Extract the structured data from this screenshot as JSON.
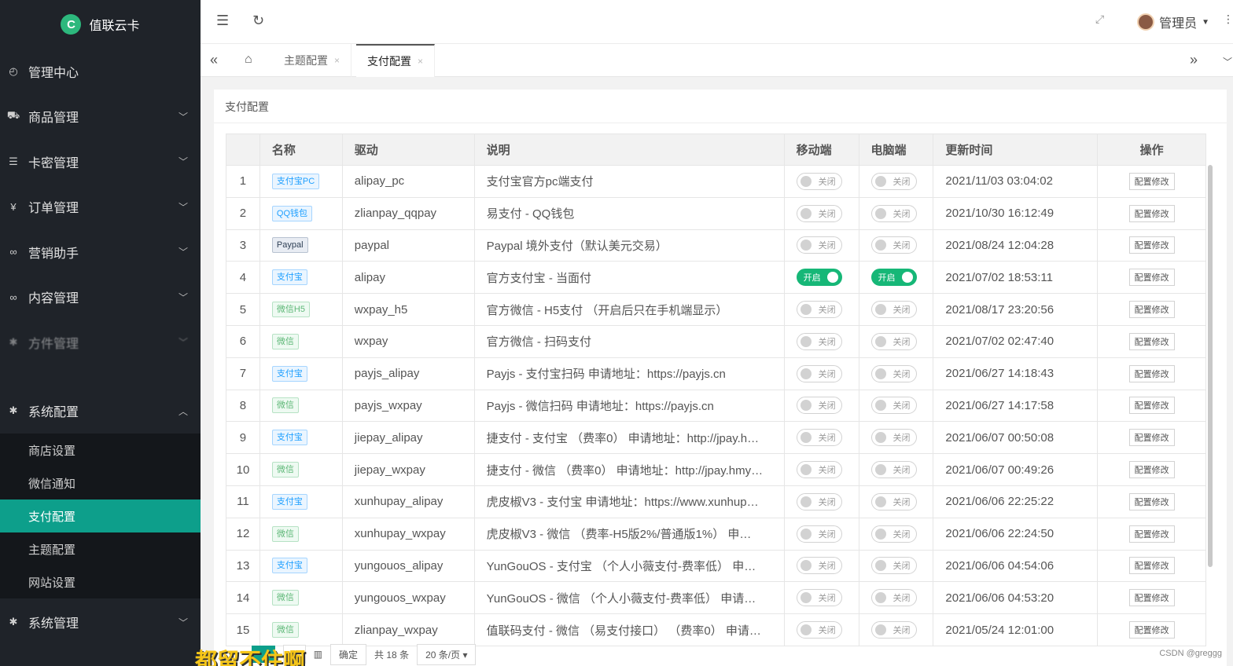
{
  "brand": {
    "name": "值联云卡",
    "logo_letter": "C"
  },
  "sidebar": {
    "items": [
      {
        "label": "管理中心",
        "icon": "dashboard-icon",
        "glyph": "◴"
      },
      {
        "label": "商品管理",
        "icon": "cart-icon",
        "glyph": "⛟"
      },
      {
        "label": "卡密管理",
        "icon": "stack-icon",
        "glyph": "☰"
      },
      {
        "label": "订单管理",
        "icon": "yen-icon",
        "glyph": "¥"
      },
      {
        "label": "营销助手",
        "icon": "link-icon",
        "glyph": "∞"
      },
      {
        "label": "内容管理",
        "icon": "link-icon",
        "glyph": "∞"
      },
      {
        "label": "方件管理",
        "icon": "gear-icon",
        "glyph": "✱"
      }
    ],
    "system_config": {
      "label": "系统配置",
      "icon": "gear-icon",
      "glyph": "✱"
    },
    "sub_items": [
      "商店设置",
      "微信通知",
      "支付配置",
      "主题配置",
      "网站设置"
    ],
    "active_sub": "支付配置",
    "system_manage": {
      "label": "系统管理",
      "icon": "gear-icon",
      "glyph": "✱"
    }
  },
  "topbar": {
    "admin_label": "管理员"
  },
  "tabs": [
    {
      "label": "主题配置"
    },
    {
      "label": "支付配置"
    }
  ],
  "card": {
    "title": "支付配置"
  },
  "table": {
    "headers": [
      "名称",
      "驱动",
      "说明",
      "移动端",
      "电脑端",
      "更新时间",
      "操作"
    ],
    "switch_off": "关闭",
    "switch_on": "开启",
    "op_label": "配置修改",
    "rows": [
      {
        "id": "1",
        "name": "支付宝PC",
        "color": "blue",
        "driver": "alipay_pc",
        "desc": "支付宝官方pc端支付",
        "mobile": false,
        "pc": false,
        "time": "2021/11/03 03:04:02"
      },
      {
        "id": "2",
        "name": "QQ钱包",
        "color": "blue",
        "driver": "zlianpay_qqpay",
        "desc": "易支付 - QQ钱包",
        "mobile": false,
        "pc": false,
        "time": "2021/10/30 16:12:49"
      },
      {
        "id": "3",
        "name": "Paypal",
        "color": "navy",
        "driver": "paypal",
        "desc": "Paypal 境外支付（默认美元交易）",
        "mobile": false,
        "pc": false,
        "time": "2021/08/24 12:04:28"
      },
      {
        "id": "4",
        "name": "支付宝",
        "color": "blue",
        "driver": "alipay",
        "desc": "官方支付宝 - 当面付",
        "mobile": true,
        "pc": true,
        "time": "2021/07/02 18:53:11"
      },
      {
        "id": "5",
        "name": "微信H5",
        "color": "green",
        "driver": "wxpay_h5",
        "desc": "官方微信 - H5支付 （开启后只在手机端显示）",
        "mobile": false,
        "pc": false,
        "time": "2021/08/17 23:20:56"
      },
      {
        "id": "6",
        "name": "微信",
        "color": "green",
        "driver": "wxpay",
        "desc": "官方微信 - 扫码支付",
        "mobile": false,
        "pc": false,
        "time": "2021/07/02 02:47:40"
      },
      {
        "id": "7",
        "name": "支付宝",
        "color": "blue",
        "driver": "payjs_alipay",
        "desc": "Payjs - 支付宝扫码 申请地址：https://payjs.cn",
        "mobile": false,
        "pc": false,
        "time": "2021/06/27 14:18:43"
      },
      {
        "id": "8",
        "name": "微信",
        "color": "green",
        "driver": "payjs_wxpay",
        "desc": "Payjs - 微信扫码 申请地址：https://payjs.cn",
        "mobile": false,
        "pc": false,
        "time": "2021/06/27 14:17:58"
      },
      {
        "id": "9",
        "name": "支付宝",
        "color": "blue",
        "driver": "jiepay_alipay",
        "desc": "捷支付 - 支付宝 （费率0） 申请地址：http://jpay.h…",
        "mobile": false,
        "pc": false,
        "time": "2021/06/07 00:50:08"
      },
      {
        "id": "10",
        "name": "微信",
        "color": "green",
        "driver": "jiepay_wxpay",
        "desc": "捷支付 - 微信 （费率0） 申请地址：http://jpay.hmy…",
        "mobile": false,
        "pc": false,
        "time": "2021/06/07 00:49:26"
      },
      {
        "id": "11",
        "name": "支付宝",
        "color": "blue",
        "driver": "xunhupay_alipay",
        "desc": "虎皮椒V3 - 支付宝 申请地址：https://www.xunhup…",
        "mobile": false,
        "pc": false,
        "time": "2021/06/06 22:25:22"
      },
      {
        "id": "12",
        "name": "微信",
        "color": "green",
        "driver": "xunhupay_wxpay",
        "desc": "虎皮椒V3 - 微信 （费率-H5版2%/普通版1%） 申…",
        "mobile": false,
        "pc": false,
        "time": "2021/06/06 22:24:50"
      },
      {
        "id": "13",
        "name": "支付宝",
        "color": "blue",
        "driver": "yungouos_alipay",
        "desc": "YunGouOS - 支付宝 （个人小薇支付-费率低） 申…",
        "mobile": false,
        "pc": false,
        "time": "2021/06/06 04:54:06"
      },
      {
        "id": "14",
        "name": "微信",
        "color": "green",
        "driver": "yungouos_wxpay",
        "desc": "YunGouOS - 微信 （个人小薇支付-费率低） 申请…",
        "mobile": false,
        "pc": false,
        "time": "2021/06/06 04:53:20"
      },
      {
        "id": "15",
        "name": "微信",
        "color": "green",
        "driver": "zlianpay_wxpay",
        "desc": "值联码支付 - 微信 （易支付接口） （费率0） 申请…",
        "mobile": false,
        "pc": false,
        "time": "2021/05/24 12:01:00"
      }
    ]
  },
  "pager": {
    "page": "1",
    "confirm": "确定",
    "total": "共 18 条",
    "size": "20 条/页"
  },
  "overlay_text": "都留不住啊",
  "watermark": "CSDN @greggg"
}
